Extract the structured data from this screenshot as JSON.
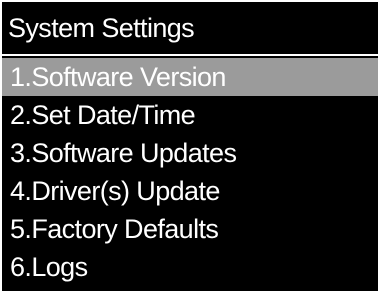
{
  "header": {
    "title": "System Settings"
  },
  "menu": {
    "selected_index": 0,
    "items": [
      {
        "number": "1.",
        "label": "Software Version"
      },
      {
        "number": "2.",
        "label": "Set Date/Time"
      },
      {
        "number": "3.",
        "label": "Software Updates"
      },
      {
        "number": "4.",
        "label": "Driver(s) Update"
      },
      {
        "number": "5.",
        "label": "Factory Defaults"
      },
      {
        "number": "6.",
        "label": "Logs"
      }
    ]
  },
  "colors": {
    "background": "#000000",
    "text": "#ffffff",
    "selection_highlight": "#9b9b9b"
  }
}
